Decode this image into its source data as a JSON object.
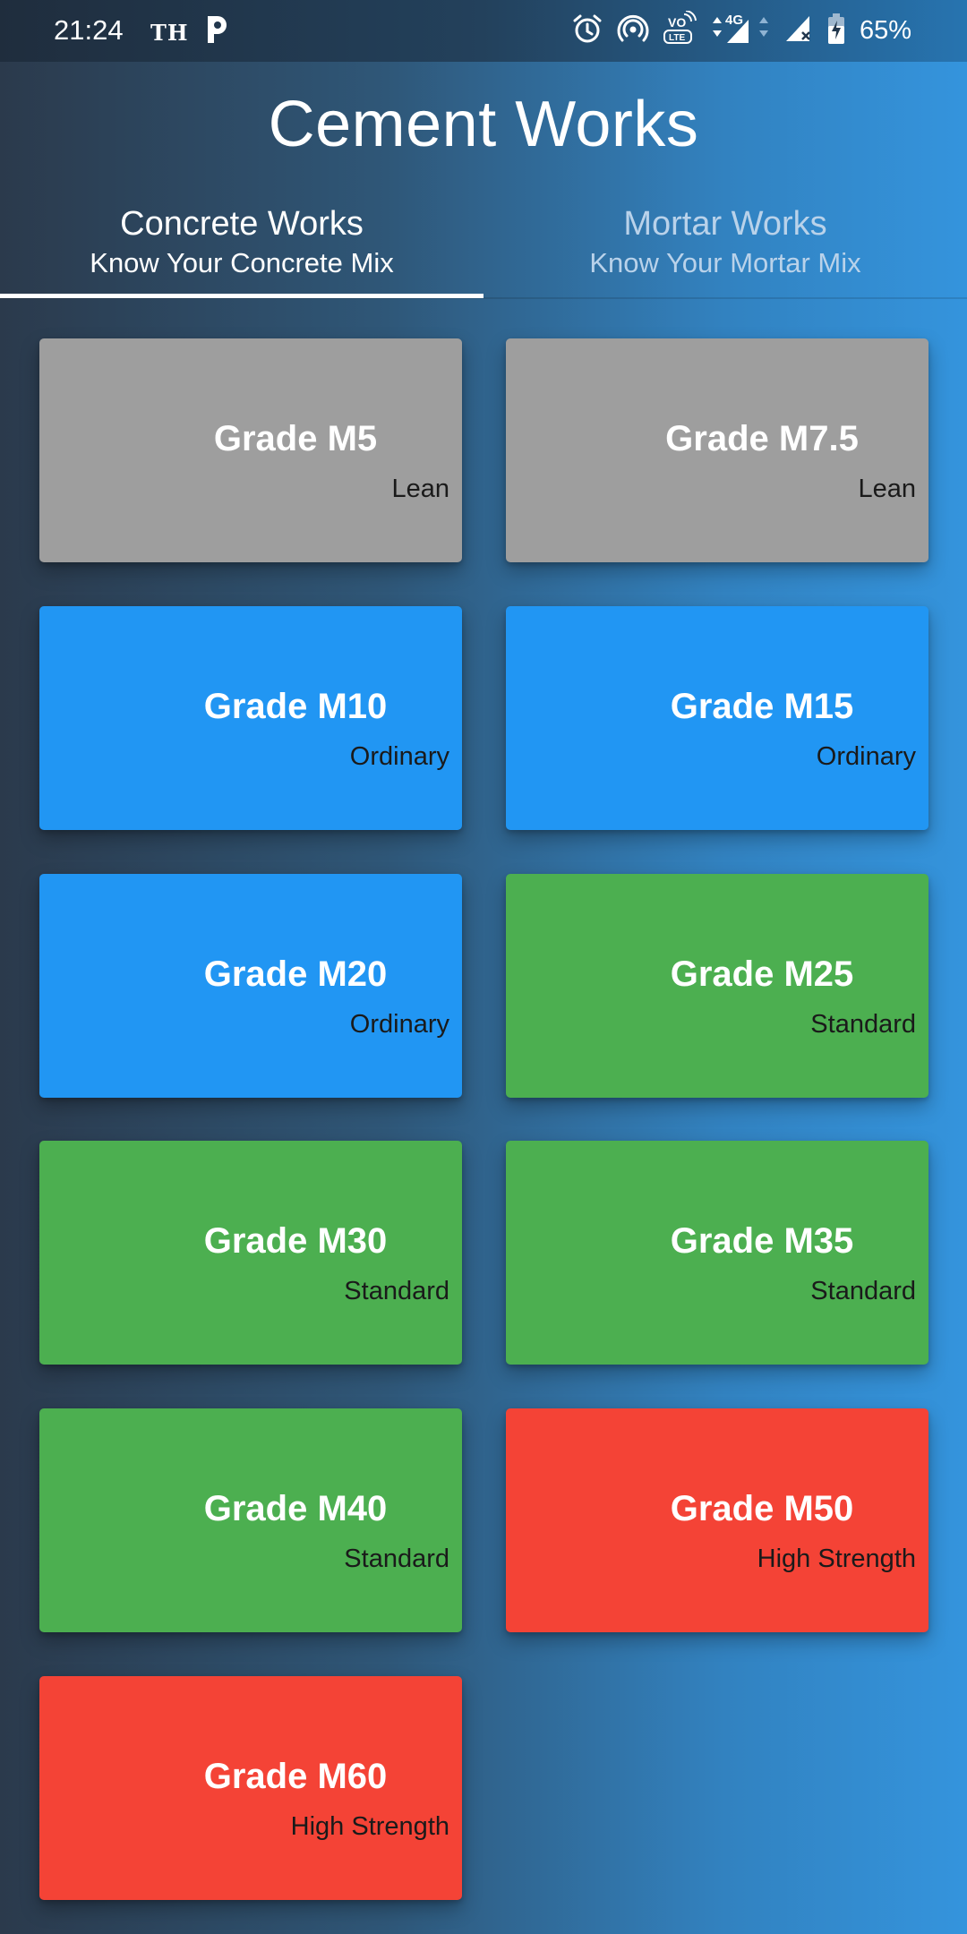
{
  "status_bar": {
    "time": "21:24",
    "carrier_badge": "TH",
    "network": "4G",
    "battery": "65%",
    "icons": [
      "p-app-icon",
      "alarm-icon",
      "hotspot-icon",
      "volte-icon",
      "signal-4g-icon",
      "signal-icon",
      "battery-charging-icon"
    ]
  },
  "app": {
    "title": "Cement Works"
  },
  "tabs": [
    {
      "title": "Concrete Works",
      "subtitle": "Know Your Concrete Mix",
      "selected": true
    },
    {
      "title": "Mortar Works",
      "subtitle": "Know Your Mortar Mix",
      "selected": false
    }
  ],
  "colors": {
    "lean": "#9e9e9e",
    "ordinary": "#2196f3",
    "standard": "#4caf50",
    "high_strength": "#f44336",
    "tab_indicator": "#ffffff"
  },
  "grades": [
    {
      "name": "Grade M5",
      "category": "Lean",
      "color": "#9e9e9e"
    },
    {
      "name": "Grade M7.5",
      "category": "Lean",
      "color": "#9e9e9e"
    },
    {
      "name": "Grade M10",
      "category": "Ordinary",
      "color": "#2196f3"
    },
    {
      "name": "Grade M15",
      "category": "Ordinary",
      "color": "#2196f3"
    },
    {
      "name": "Grade M20",
      "category": "Ordinary",
      "color": "#2196f3"
    },
    {
      "name": "Grade M25",
      "category": "Standard",
      "color": "#4caf50"
    },
    {
      "name": "Grade M30",
      "category": "Standard",
      "color": "#4caf50"
    },
    {
      "name": "Grade M35",
      "category": "Standard",
      "color": "#4caf50"
    },
    {
      "name": "Grade M40",
      "category": "Standard",
      "color": "#4caf50"
    },
    {
      "name": "Grade M50",
      "category": "High Strength",
      "color": "#f44336"
    },
    {
      "name": "Grade M60",
      "category": "High Strength",
      "color": "#f44336"
    }
  ]
}
